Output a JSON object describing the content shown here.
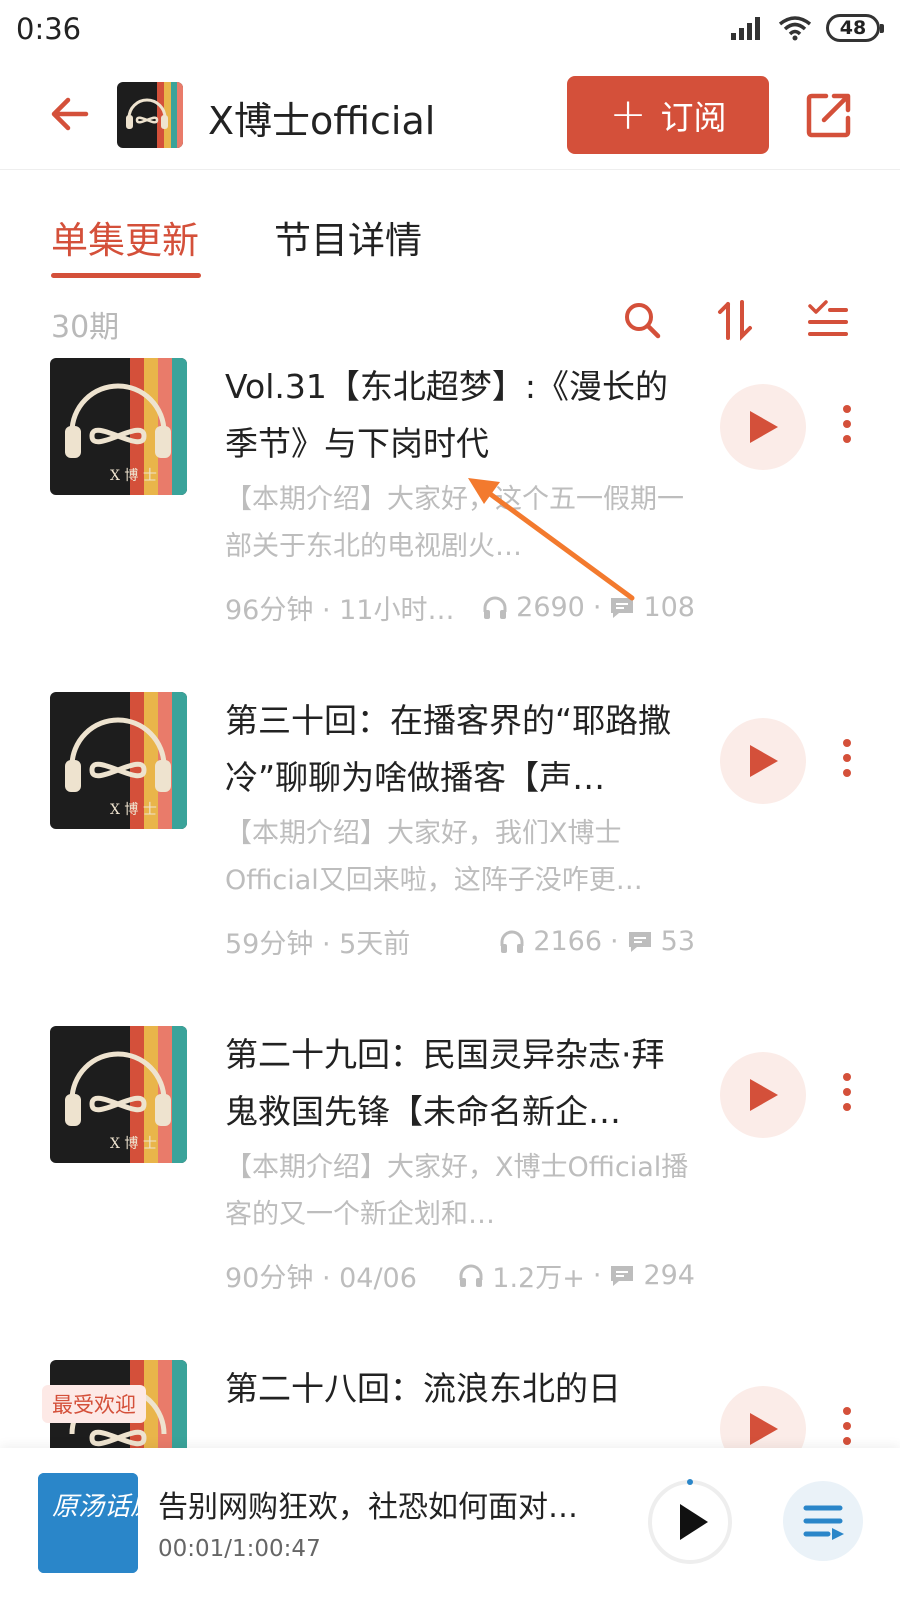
{
  "status_bar": {
    "time": "0:36",
    "battery": "48",
    "icons": [
      "signal-icon",
      "wifi-icon",
      "battery-icon"
    ]
  },
  "header": {
    "back_icon": "back-arrow-icon",
    "podcast_name": "X博士official",
    "subscribe_label": "订阅",
    "subscribe_icon": "plus-icon",
    "share_icon": "share-icon"
  },
  "tabs": [
    {
      "label": "单集更新",
      "active": true
    },
    {
      "label": "节目详情",
      "active": false
    }
  ],
  "toolbar": {
    "episode_count": "30期",
    "icons": [
      "search-icon",
      "sort-icon",
      "filter-list-icon"
    ]
  },
  "episodes": [
    {
      "title": "Vol.31【东北超梦】:《漫长的季节》与下岗时代",
      "description": "【本期介绍】大家好，这个五一假期一部关于东北的电视剧火…",
      "duration": "96分钟 · 11小时…",
      "plays": "2690",
      "comments": "108"
    },
    {
      "title": "第三十回：在播客界的“耶路撒冷”聊聊为啥做播客【声…",
      "description": "【本期介绍】大家好，我们X博士Official又回来啦，这阵子没咋更…",
      "duration": "59分钟 · 5天前",
      "plays": "2166",
      "comments": "53"
    },
    {
      "title": "第二十九回：民国灵异杂志·拜鬼救国先锋【未命名新企…",
      "description": "【本期介绍】大家好，X博士Official播客的又一个新企划和…",
      "duration": "90分钟 · 04/06",
      "plays": "1.2万+",
      "comments": "294"
    },
    {
      "title": "第二十八回：流浪东北的日",
      "badge": "最受欢迎"
    }
  ],
  "player": {
    "title": "告别网购狂欢，社恐如何面对…",
    "time": "00:01/1:00:47",
    "cover_text": "原汤话原食"
  },
  "colors": {
    "accent": "#d4503a",
    "muted_text": "#bdbdbd",
    "play_bg": "#fbece8"
  }
}
